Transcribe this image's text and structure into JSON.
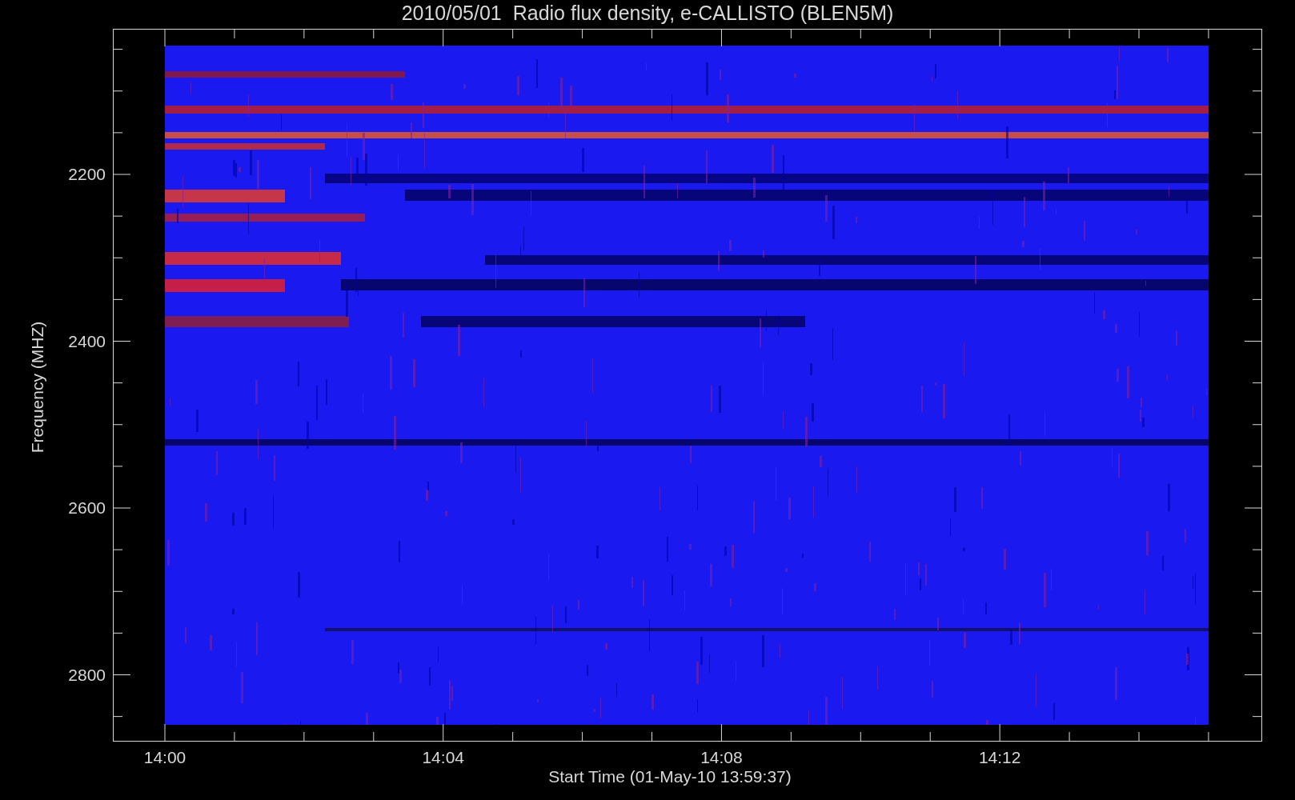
{
  "title": "2010/05/01  Radio flux density, e-CALLISTO (BLEN5M)",
  "xlabel": "Start Time (01-May-10 13:59:37)",
  "ylabel": "Frequency (MHZ)",
  "xtick_labels": [
    "14:00",
    "14:04",
    "14:08",
    "14:12"
  ],
  "ytick_labels": [
    "2200",
    "2400",
    "2600",
    "2800"
  ]
}
